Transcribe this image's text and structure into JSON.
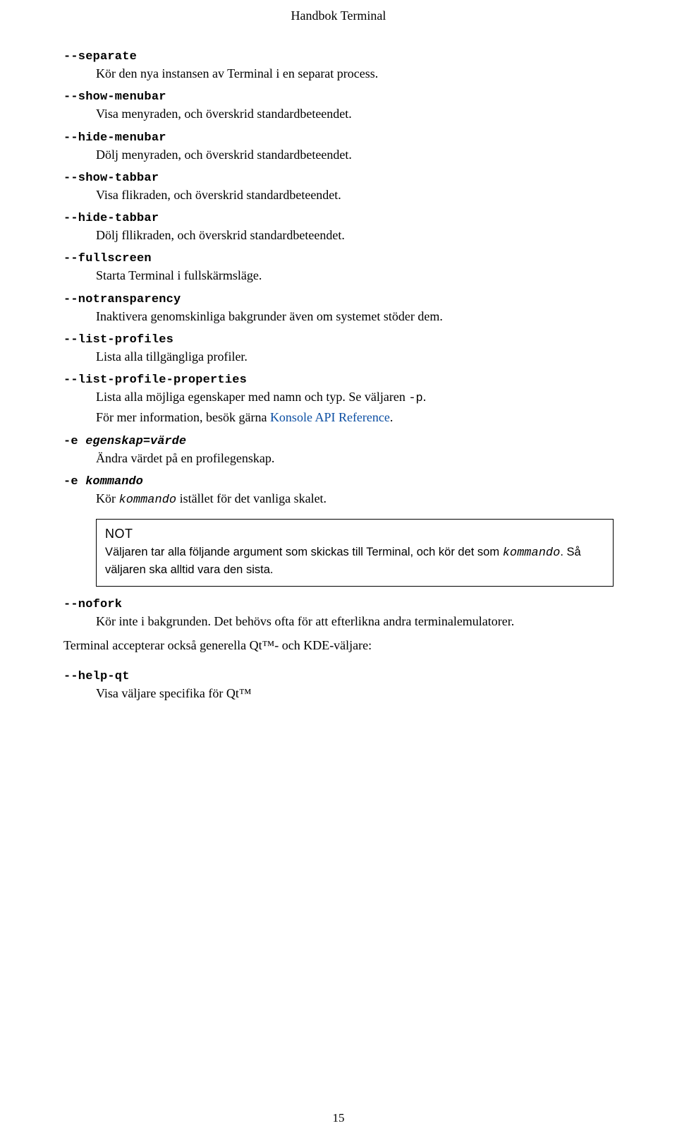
{
  "header": "Handbok Terminal",
  "options": {
    "separate": {
      "name": "--separate",
      "desc": "Kör den nya instansen av Terminal i en separat process."
    },
    "show_menubar": {
      "name": "--show-menubar",
      "desc": "Visa menyraden, och överskrid standardbeteendet."
    },
    "hide_menubar": {
      "name": "--hide-menubar",
      "desc": "Dölj menyraden, och överskrid standardbeteendet."
    },
    "show_tabbar": {
      "name": "--show-tabbar",
      "desc": "Visa flikraden, och överskrid standardbeteendet."
    },
    "hide_tabbar": {
      "name": "--hide-tabbar",
      "desc": "Dölj fllikraden, och överskrid standardbeteendet."
    },
    "fullscreen": {
      "name": "--fullscreen",
      "desc": "Starta Terminal i fullskärmsläge."
    },
    "notransparency": {
      "name": "--notransparency",
      "desc": "Inaktivera genomskinliga bakgrunder även om systemet stöder dem."
    },
    "list_profiles": {
      "name": "--list-profiles",
      "desc": "Lista alla tillgängliga profiler."
    },
    "list_profile_properties": {
      "name": "--list-profile-properties",
      "desc1_pre": "Lista alla möjliga egenskaper med namn och typ. Se väljaren ",
      "desc1_opt": "-p",
      "desc1_post": ".",
      "desc2_pre": "För mer information, besök gärna ",
      "desc2_link": "Konsole API Reference",
      "desc2_post": "."
    },
    "e_prop": {
      "name": "-e ",
      "arg": "egenskap=värde",
      "desc": "Ändra värdet på en profilegenskap."
    },
    "e_cmd": {
      "name": "-e ",
      "arg": "kommando",
      "desc_pre": "Kör ",
      "desc_code": "kommando",
      "desc_post": " istället för det vanliga skalet."
    },
    "nofork": {
      "name": "--nofork",
      "desc": "Kör inte i bakgrunden. Det behövs ofta för att efterlikna andra terminalemulatorer."
    },
    "help_qt": {
      "name": "--help-qt",
      "desc": "Visa väljare specifika för Qt™"
    }
  },
  "note": {
    "title": "NOT",
    "body_pre": "Väljaren tar alla följande argument som skickas till Terminal, och kör det som ",
    "body_code": "kommando",
    "body_post": ". Så väljaren ska alltid vara den sista."
  },
  "generic_paragraph": "Terminal accepterar också generella Qt™- och KDE-väljare:",
  "page_number": "15"
}
